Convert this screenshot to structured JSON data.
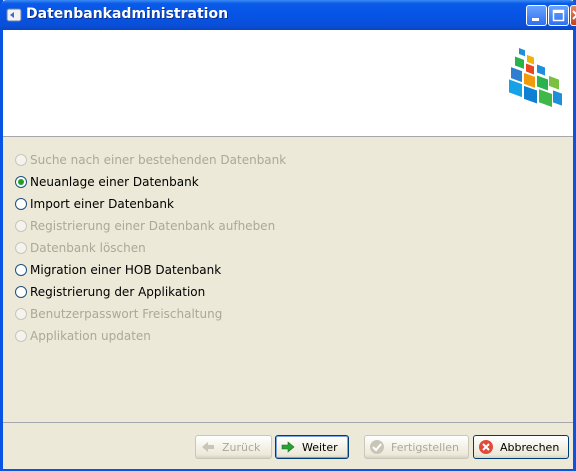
{
  "window": {
    "title": "Datenbankadministration"
  },
  "options": [
    {
      "label": "Suche nach einer bestehenden Datenbank",
      "enabled": false,
      "checked": false
    },
    {
      "label": "Neuanlage einer Datenbank",
      "enabled": true,
      "checked": true
    },
    {
      "label": "Import einer Datenbank",
      "enabled": true,
      "checked": false
    },
    {
      "label": "Registrierung einer Datenbank aufheben",
      "enabled": false,
      "checked": false
    },
    {
      "label": "Datenbank löschen",
      "enabled": false,
      "checked": false
    },
    {
      "label": "Migration einer HOB Datenbank",
      "enabled": true,
      "checked": false
    },
    {
      "label": "Registrierung der Applikation",
      "enabled": true,
      "checked": false
    },
    {
      "label": "Benutzerpasswort Freischaltung",
      "enabled": false,
      "checked": false
    },
    {
      "label": "Applikation updaten",
      "enabled": false,
      "checked": false
    }
  ],
  "buttons": {
    "back": {
      "label": "Zurück",
      "enabled": false
    },
    "next": {
      "label": "Weiter",
      "enabled": true
    },
    "finish": {
      "label": "Fertigstellen",
      "enabled": false
    },
    "cancel": {
      "label": "Abbrechen",
      "enabled": true
    }
  },
  "icons": {
    "back": "arrow-left-icon",
    "next": "arrow-right-icon",
    "finish": "check-icon",
    "cancel": "cancel-icon"
  }
}
